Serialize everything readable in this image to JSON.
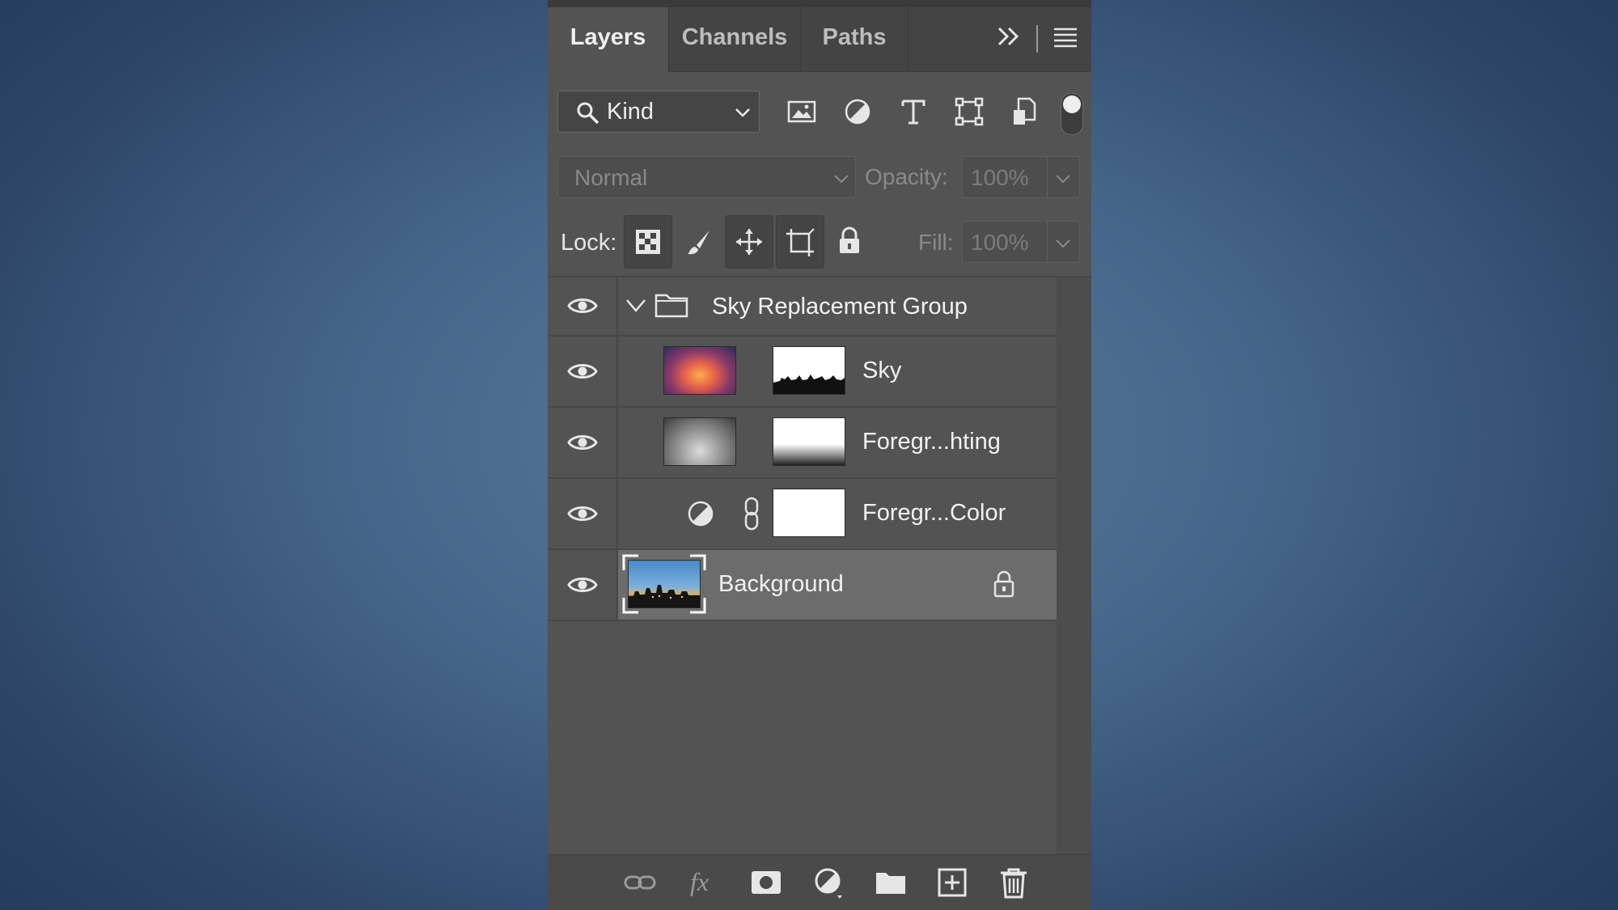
{
  "panel": {
    "tabs": [
      {
        "label": "Layers",
        "active": true
      },
      {
        "label": "Channels",
        "active": false
      },
      {
        "label": "Paths",
        "active": false
      }
    ],
    "tab_icons": [
      "double-chevron-right-icon",
      "panel-menu-icon"
    ]
  },
  "filter": {
    "kind_label": "Kind",
    "icons": [
      "pixel-layer-filter-icon",
      "adjustment-layer-filter-icon",
      "type-layer-filter-icon",
      "shape-layer-filter-icon",
      "smart-object-filter-icon"
    ],
    "toggle_on": true
  },
  "blend": {
    "mode": "Normal",
    "opacity_label": "Opacity:",
    "opacity_value": "100%",
    "fill_label": "Fill:",
    "fill_value": "100%"
  },
  "lock": {
    "label": "Lock:",
    "icons": [
      "lock-transparent-pixels-icon",
      "lock-image-pixels-icon",
      "lock-position-icon",
      "lock-artboard-icon",
      "lock-all-icon"
    ]
  },
  "layers": [
    {
      "name": "Sky Replacement Group",
      "type": "group",
      "visible": true
    },
    {
      "name": "Sky",
      "type": "pixel-with-mask",
      "visible": true
    },
    {
      "name": "Foregr...hting",
      "type": "pixel-with-mask",
      "visible": true
    },
    {
      "name": "Foregr...Color",
      "type": "adjustment",
      "visible": true
    },
    {
      "name": "Background",
      "type": "background",
      "visible": true,
      "selected": true,
      "locked": true
    }
  ],
  "bottom_icons": [
    "link-layers-icon",
    "fx-icon",
    "add-mask-icon",
    "new-adjustment-icon",
    "new-group-icon",
    "new-layer-icon",
    "delete-layer-icon"
  ],
  "colors": {
    "panel": "#535353",
    "selected_row": "#6c6c6c",
    "background": "#45668a"
  }
}
